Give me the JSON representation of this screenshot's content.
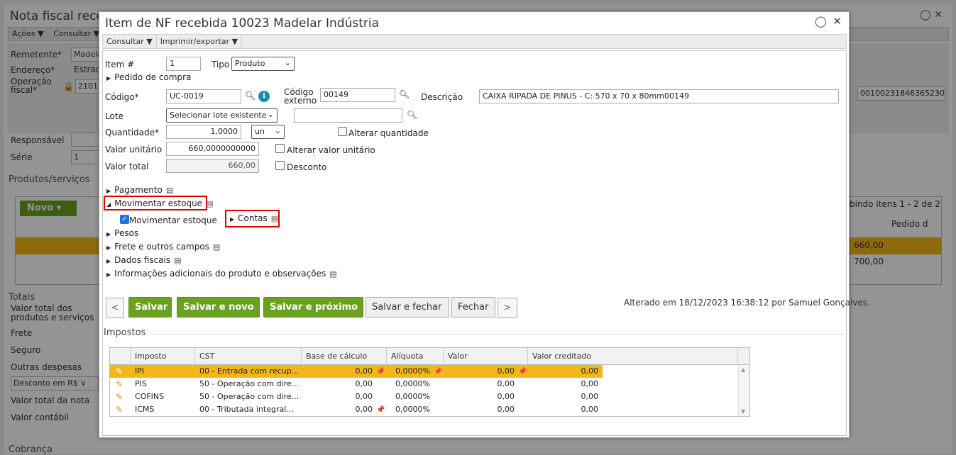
{
  "background": {
    "title": "Nota fiscal rece",
    "menu": [
      "Ações ▼",
      "Consultar ▼"
    ],
    "fields": {
      "remetente_label": "Remetente*",
      "remetente_value": "Madela",
      "endereco_label": "Endereço*",
      "endereco_value": "Estrad",
      "operacao_label": "Operação fiscal*",
      "operacao_value": "2101",
      "responsavel_label": "Responsável",
      "serie_label": "Série",
      "serie_value": "1",
      "chave_value": "00100231846365230"
    },
    "produtos_title": "Produtos/serviços",
    "novo_label": "Novo",
    "exibindo": "bindo itens 1 - 2 de 2",
    "pedido_header": "Pedido d",
    "row_values": [
      "660,00",
      "700,00"
    ],
    "totais": {
      "title": "Totais",
      "valor_total_produtos": "Valor total dos produtos e serviços",
      "frete": "Frete",
      "seguro": "Seguro",
      "outras_despesas": "Outras despesas",
      "desconto_select": "Desconto em R$",
      "valor_total_nota": "Valor total da nota",
      "valor_contabil": "Valor contábil",
      "cobranca": "Cobrança"
    }
  },
  "modal": {
    "title": "Item de NF recebida 10023 Madelar Indústria",
    "menu": {
      "consultar": "Consultar ▼",
      "imprimir": "Imprimir/exportar ▼"
    },
    "item_label": "Item #",
    "item_value": "1",
    "tipo_label": "Tipo",
    "tipo_value": "Produto",
    "pedido_compra": "Pedido de compra",
    "codigo_label": "Código*",
    "codigo_value": "UC-0019",
    "codigo_externo_label": "Código externo",
    "codigo_externo_value": "00149",
    "descricao_label": "Descrição",
    "descricao_value": "CAIXA RIPADA DE PINUS - C: 570 x 70 x 80mm00149",
    "lote_label": "Lote",
    "lote_value": "Selecionar lote existente",
    "quantidade_label": "Quantidade*",
    "quantidade_value": "1,0000",
    "unidade_value": "un",
    "alterar_quantidade": "Alterar quantidade",
    "valor_unitario_label": "Valor unitário",
    "valor_unitario_value": "660,0000000000",
    "alterar_valor_unitario": "Alterar valor unitário",
    "valor_total_label": "Valor total",
    "valor_total_value": "660,00",
    "desconto": "Desconto",
    "sections": {
      "pagamento": "Pagamento",
      "movimentar_estoque": "Movimentar estoque",
      "movimentar_estoque_check": "Movimentar estoque",
      "contas": "Contas",
      "pesos": "Pesos",
      "frete": "Frete e outros campos",
      "dados_fiscais": "Dados fiscais",
      "info_adicionais": "Informações adicionais do produto e observações"
    },
    "buttons": {
      "prev": "<",
      "salvar": "Salvar",
      "salvar_novo": "Salvar e novo",
      "salvar_proximo": "Salvar e próximo",
      "salvar_fechar": "Salvar e fechar",
      "fechar": "Fechar",
      "next": ">"
    },
    "alterado": "Alterado em 18/12/2023 16:38:12 por Samuel Gonçalves.",
    "impostos_title": "Impostos",
    "impostos_table": {
      "headers": [
        "Imposto",
        "CST",
        "Base de cálculo",
        "Alíquota",
        "Valor",
        "Valor creditado"
      ],
      "rows": [
        {
          "imposto": "IPI",
          "cst": "00 - Entrada com recup...",
          "base": "0,00",
          "aliquota": "0,0000%",
          "valor": "0,00",
          "creditado": "0,00"
        },
        {
          "imposto": "PIS",
          "cst": "50 - Operação com dire...",
          "base": "0,00",
          "aliquota": "0,0000%",
          "valor": "0,00",
          "creditado": "0,00"
        },
        {
          "imposto": "COFINS",
          "cst": "50 - Operação com dire...",
          "base": "0,00",
          "aliquota": "0,0000%",
          "valor": "0,00",
          "creditado": "0,00"
        },
        {
          "imposto": "ICMS",
          "cst": "00 - Tributada integral...",
          "base": "0,00",
          "aliquota": "0,0000%",
          "valor": "0,00",
          "creditado": "0,00"
        }
      ]
    }
  },
  "colors": {
    "accent_green": "#6aa121",
    "selected_row": "#f4b71a",
    "highlight_red": "#e00000"
  }
}
